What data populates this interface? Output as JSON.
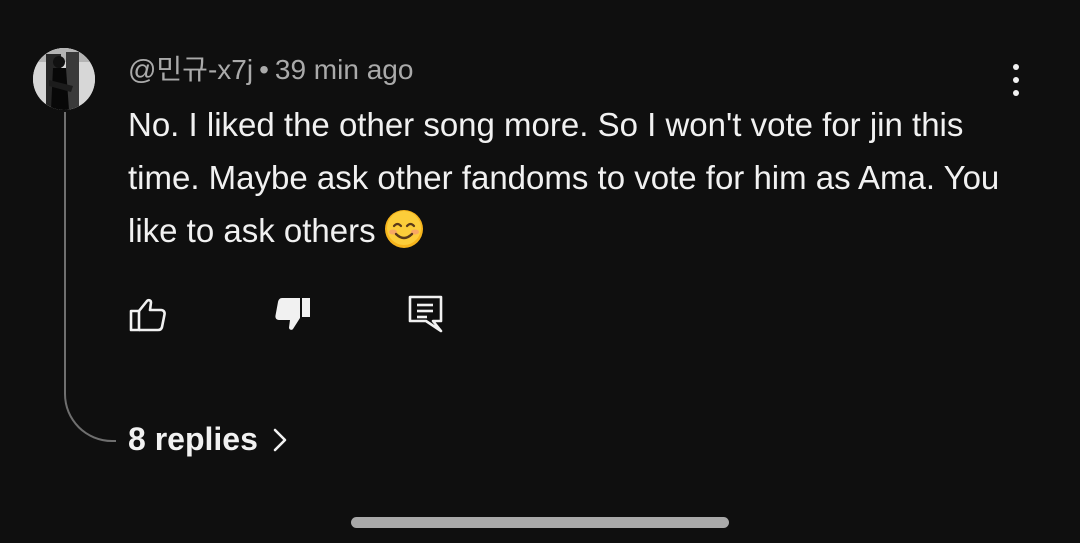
{
  "comment": {
    "author": "@민규-x7j",
    "separator": "•",
    "time": "39 min ago",
    "text": "No. I liked the other song more. So I won't vote for jin this time. Maybe ask other fandoms to vote for him as Ama. You like to ask others",
    "emoji": "smiling-face-icon"
  },
  "replies": {
    "label": "8 replies"
  },
  "icons": {
    "like": "thumbs-up-icon",
    "dislike": "thumbs-down-icon",
    "reply": "comment-icon",
    "more": "more-vertical-icon",
    "expand": "chevron-right-icon"
  },
  "colors": {
    "background": "#0f0f0f",
    "text": "#f1f1f1",
    "secondary_text": "#aaaaaa",
    "thread_line": "#6f6f6f"
  }
}
